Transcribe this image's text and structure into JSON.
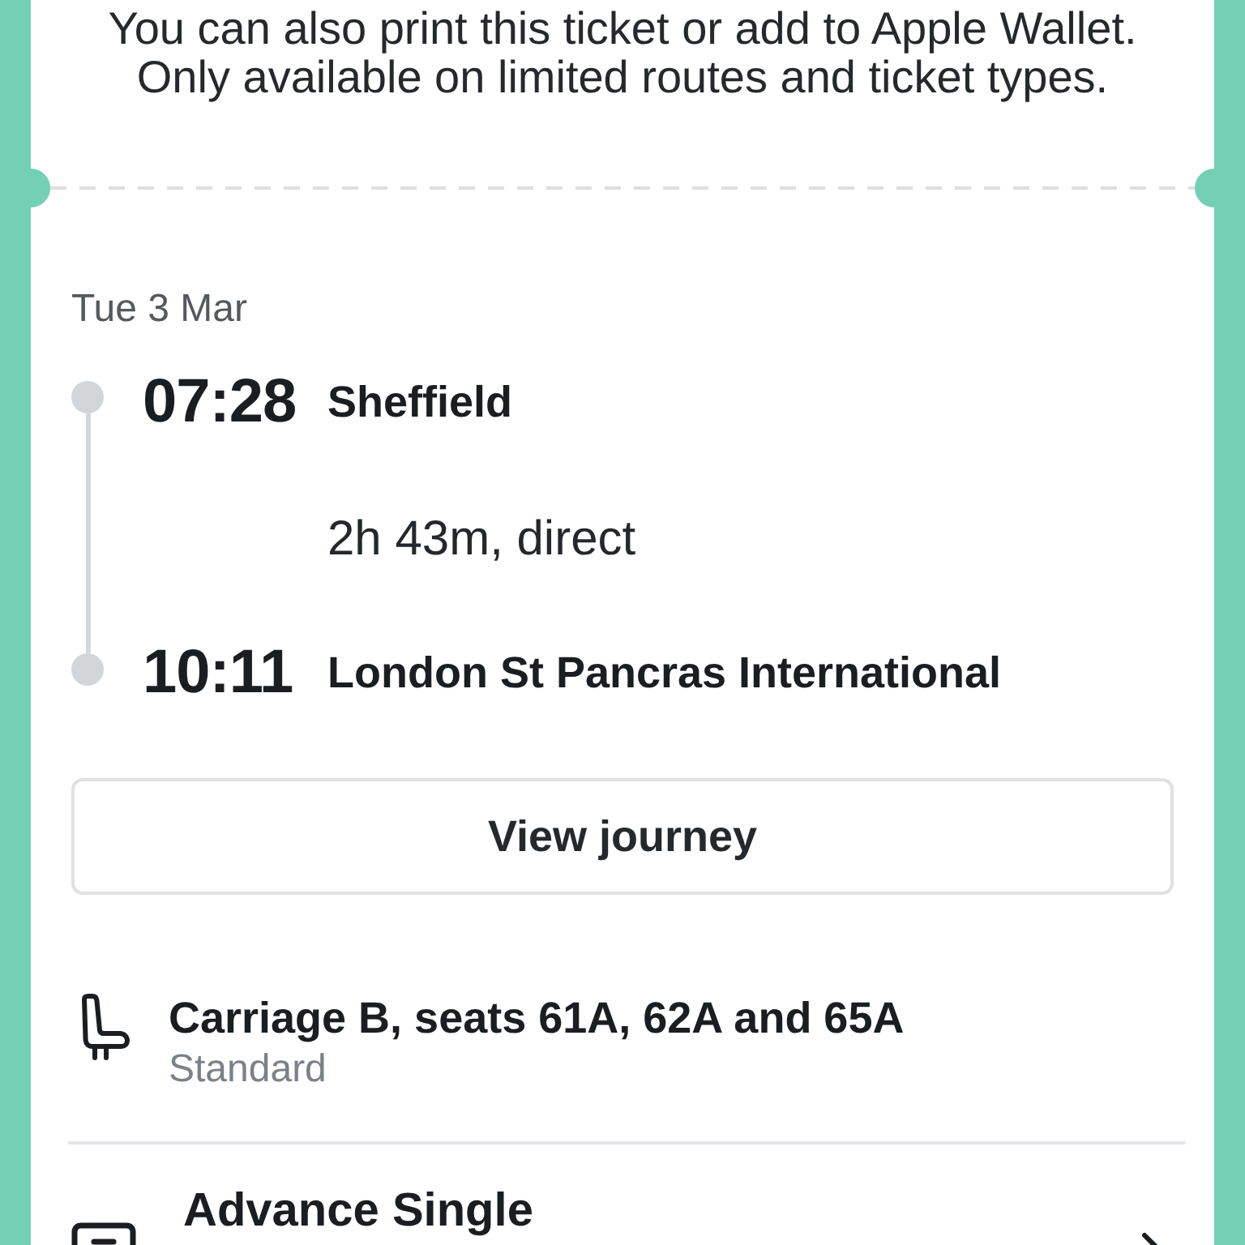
{
  "notice": {
    "text": "You can also print this ticket or add to Apple Wallet. Only available on limited routes and ticket types."
  },
  "journey": {
    "date": "Tue 3 Mar",
    "stops": [
      {
        "time": "07:28",
        "station": "Sheffield"
      },
      {
        "time": "10:11",
        "station": "London St Pancras International"
      }
    ],
    "duration": "2h 43m, direct"
  },
  "view_button": {
    "label": "View journey"
  },
  "details": [
    {
      "kind": "seat",
      "title": "Carriage B, seats 61A, 62A and 65A",
      "subtitle": "Standard",
      "chevron": false
    },
    {
      "kind": "ticket",
      "title": "Advance Single",
      "chevron": true
    }
  ]
}
